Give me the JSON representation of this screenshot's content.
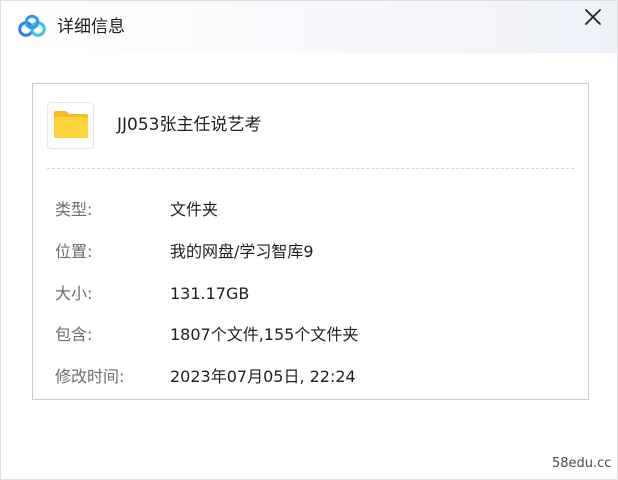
{
  "window": {
    "title": "详细信息",
    "logo_icon": "baidu-netdisk-logo-icon",
    "close_icon": "close-icon"
  },
  "file": {
    "icon": "folder-icon",
    "icon_color": "#FFD43A",
    "name": "JJ053张主任说艺考"
  },
  "details": [
    {
      "label": "类型:",
      "value": "文件夹"
    },
    {
      "label": "位置:",
      "value": "我的网盘/学习智库9"
    },
    {
      "label": "大小:",
      "value": "131.17GB"
    },
    {
      "label": "包含:",
      "value": "1807个文件,155个文件夹"
    },
    {
      "label": "修改时间:",
      "value": "2023年07月05日, 22:24"
    }
  ],
  "watermark": "58edu.cc",
  "colors": {
    "label_text": "#6B6E75",
    "value_text": "#1F1F1F",
    "logo_blue": "#2E7BF6",
    "logo_cyan": "#36C6E6"
  }
}
